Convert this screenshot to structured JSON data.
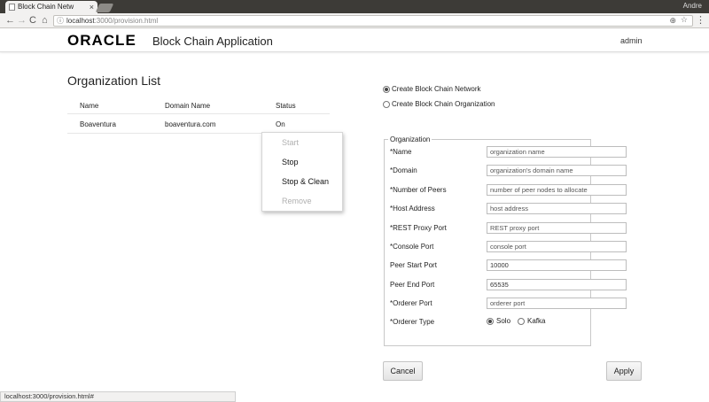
{
  "browser": {
    "tab_title": "Block Chain Netw",
    "tab_close": "×",
    "window_user": "Andre",
    "url_host": "localhost",
    "url_rest": ":3000/provision.html",
    "nav_back": "←",
    "nav_forward": "→",
    "nav_reload": "C",
    "nav_home": "⌂",
    "omni_info_icon": "ⓘ",
    "zoom_icon": "⊕",
    "star_icon": "☆",
    "menu_icon": "⋮",
    "status_url": "localhost:3000/provision.html#"
  },
  "header": {
    "logo": "ORACLE",
    "app_title": "Block Chain Application",
    "user": "admin"
  },
  "org_list": {
    "title": "Organization List",
    "columns": [
      "Name",
      "Domain Name",
      "Status"
    ],
    "rows": [
      {
        "name": "Boaventura",
        "domain": "boaventura.com",
        "status": "On"
      }
    ]
  },
  "context_menu": {
    "items": [
      "Start",
      "Stop",
      "Stop & Clean",
      "Remove"
    ]
  },
  "mode": {
    "network_label": "Create Block Chain Network",
    "organization_label": "Create Block Chain Organization",
    "selected": "network"
  },
  "form": {
    "legend": "Organization",
    "fields": [
      {
        "label": "*Name",
        "placeholder": "organization name",
        "value": ""
      },
      {
        "label": "*Domain",
        "placeholder": "organization's domain name",
        "value": ""
      },
      {
        "label": "*Number of Peers",
        "placeholder": "number of peer nodes to allocate",
        "value": ""
      },
      {
        "label": "*Host Address",
        "placeholder": "host address",
        "value": ""
      },
      {
        "label": "*REST Proxy Port",
        "placeholder": "REST proxy port",
        "value": ""
      },
      {
        "label": "*Console Port",
        "placeholder": "console port",
        "value": ""
      },
      {
        "label": "Peer Start Port",
        "placeholder": "",
        "value": "10000"
      },
      {
        "label": "Peer End Port",
        "placeholder": "",
        "value": "65535"
      },
      {
        "label": "*Orderer Port",
        "placeholder": "orderer port",
        "value": ""
      }
    ],
    "orderer_type": {
      "label": "*Orderer Type",
      "options": [
        "Solo",
        "Kafka"
      ],
      "selected": "Solo"
    }
  },
  "buttons": {
    "cancel": "Cancel",
    "apply": "Apply"
  }
}
